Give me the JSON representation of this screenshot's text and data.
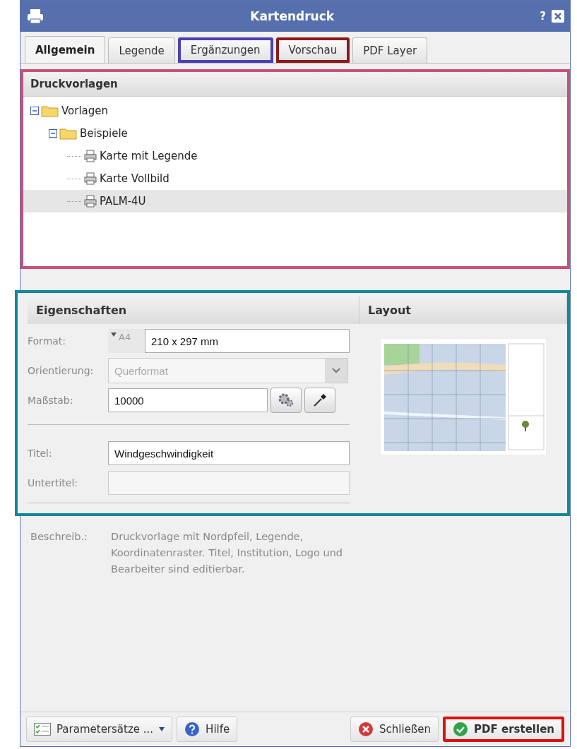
{
  "window": {
    "title": "Kartendruck",
    "help": "?"
  },
  "tabs": [
    {
      "label": "Allgemein",
      "selected": true
    },
    {
      "label": "Legende",
      "selected": false
    },
    {
      "label": "Ergänzungen",
      "selected": false,
      "color": "#4a3fb5"
    },
    {
      "label": "Vorschau",
      "selected": false,
      "color": "#8b1a1a"
    },
    {
      "label": "PDF Layer",
      "selected": false
    }
  ],
  "templates": {
    "title": "Druckvorlagen",
    "color": "#c9507a",
    "tree": [
      {
        "label": "Vorlagen",
        "kind": "folder",
        "expanded": true,
        "selected": false,
        "children": [
          {
            "label": "Beispiele",
            "kind": "folder",
            "expanded": true,
            "selected": false,
            "children": [
              {
                "label": "Karte mit Legende",
                "kind": "template",
                "selected": false
              },
              {
                "label": "Karte Vollbild",
                "kind": "template",
                "selected": false
              },
              {
                "label": "PALM-4U",
                "kind": "template",
                "selected": true
              }
            ]
          }
        ]
      }
    ]
  },
  "properties": {
    "title": "Eigenschaften",
    "layout_title": "Layout",
    "color": "#11899a",
    "format": {
      "label": "Format:",
      "size": "A4",
      "value": "210 x 297 mm"
    },
    "orientation": {
      "label": "Orientierung:",
      "value": "Querformat",
      "disabled": true
    },
    "scale": {
      "label": "Maßstab:",
      "value": "10000"
    },
    "title_field": {
      "label": "Titel:",
      "value": "Windgeschwindigkeit"
    },
    "subtitle_field": {
      "label": "Untertitel:"
    }
  },
  "description": {
    "label": "Beschreib.:",
    "text": "Druckvorlage mit Nordpfeil, Legende, Koordinatenraster. Titel, Institution, Logo und Bearbeiter sind editierbar."
  },
  "footer": {
    "param_sets": "Parametersätze ...",
    "help": "Hilfe",
    "close": "Schließen",
    "create": {
      "label": "PDF erstellen",
      "color": "#e01010"
    }
  }
}
